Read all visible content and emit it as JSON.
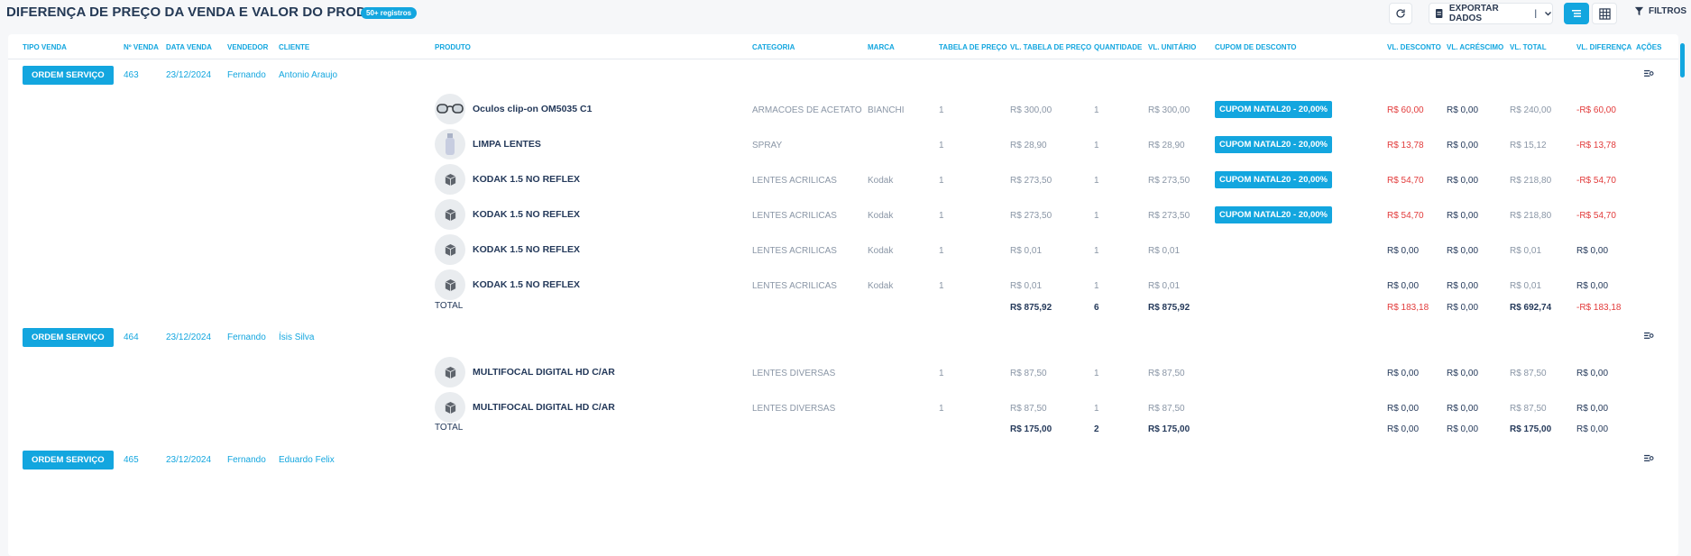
{
  "header": {
    "title": "DIFERENÇA DE PREÇO DA VENDA E VALOR DO PRODUTO",
    "badge": "50+ registros",
    "export_label": "EXPORTAR DADOS",
    "export_sep": "|",
    "filters_label": "FILTROS"
  },
  "columns": {
    "tipo": "TIPO VENDA",
    "nvenda": "Nº VENDA",
    "data": "DATA VENDA",
    "vendedor": "VENDEDOR",
    "cliente": "CLIENTE",
    "produto": "PRODUTO",
    "categoria": "CATEGORIA",
    "marca": "MARCA",
    "tabela": "TABELA DE PREÇO",
    "vltabela": "VL. TABELA DE PREÇO",
    "qtd": "QUANTIDADE",
    "vlunit": "VL. UNITÁRIO",
    "cupom": "CUPOM DE DESCONTO",
    "vldesc": "VL. DESCONTO",
    "vlacres": "VL. ACRÉSCIMO",
    "vltotal": "VL. TOTAL",
    "vldif": "VL. DIFERENÇA",
    "acoes": "AÇÕES"
  },
  "colors": {
    "accent": "#13a6df",
    "text": "#24395a",
    "muted": "#8a96a6",
    "negative": "#e23b3b"
  },
  "sales": [
    {
      "tipo": "ORDEM SERVIÇO",
      "numero": "463",
      "data": "23/12/2024",
      "vendedor": "Fernando",
      "cliente": "Antonio Araujo",
      "items": [
        {
          "produto": "Oculos clip-on OM5035 C1",
          "thumb": "glasses",
          "categoria": "ARMACOES DE ACETATO",
          "marca": "BIANCHI",
          "tabela": "1",
          "vltabela": "R$ 300,00",
          "qtd": "1",
          "vlunit": "R$ 300,00",
          "cupom": "CUPOM NATAL20 - 20,00%",
          "vldesc": "R$ 60,00",
          "vlacres": "R$ 0,00",
          "vltotal": "R$ 240,00",
          "vldif": "-R$ 60,00",
          "neg": true
        },
        {
          "produto": "LIMPA LENTES",
          "thumb": "spray",
          "categoria": "SPRAY",
          "marca": "",
          "tabela": "1",
          "vltabela": "R$ 28,90",
          "qtd": "1",
          "vlunit": "R$ 28,90",
          "cupom": "CUPOM NATAL20 - 20,00%",
          "vldesc": "R$ 13,78",
          "vlacres": "R$ 0,00",
          "vltotal": "R$ 15,12",
          "vldif": "-R$ 13,78",
          "neg": true
        },
        {
          "produto": "KODAK 1.5 NO REFLEX",
          "thumb": "box",
          "categoria": "LENTES ACRILICAS",
          "marca": "Kodak",
          "tabela": "1",
          "vltabela": "R$ 273,50",
          "qtd": "1",
          "vlunit": "R$ 273,50",
          "cupom": "CUPOM NATAL20 - 20,00%",
          "vldesc": "R$ 54,70",
          "vlacres": "R$ 0,00",
          "vltotal": "R$ 218,80",
          "vldif": "-R$ 54,70",
          "neg": true
        },
        {
          "produto": "KODAK 1.5 NO REFLEX",
          "thumb": "box",
          "categoria": "LENTES ACRILICAS",
          "marca": "Kodak",
          "tabela": "1",
          "vltabela": "R$ 273,50",
          "qtd": "1",
          "vlunit": "R$ 273,50",
          "cupom": "CUPOM NATAL20 - 20,00%",
          "vldesc": "R$ 54,70",
          "vlacres": "R$ 0,00",
          "vltotal": "R$ 218,80",
          "vldif": "-R$ 54,70",
          "neg": true
        },
        {
          "produto": "KODAK 1.5 NO REFLEX",
          "thumb": "box",
          "categoria": "LENTES ACRILICAS",
          "marca": "Kodak",
          "tabela": "1",
          "vltabela": "R$ 0,01",
          "qtd": "1",
          "vlunit": "R$ 0,01",
          "cupom": "",
          "vldesc": "R$ 0,00",
          "vlacres": "R$ 0,00",
          "vltotal": "R$ 0,01",
          "vldif": "R$ 0,00",
          "neg": false
        },
        {
          "produto": "KODAK 1.5 NO REFLEX",
          "thumb": "box",
          "categoria": "LENTES ACRILICAS",
          "marca": "Kodak",
          "tabela": "1",
          "vltabela": "R$ 0,01",
          "qtd": "1",
          "vlunit": "R$ 0,01",
          "cupom": "",
          "vldesc": "R$ 0,00",
          "vlacres": "R$ 0,00",
          "vltotal": "R$ 0,01",
          "vldif": "R$ 0,00",
          "neg": false
        }
      ],
      "total": {
        "label": "TOTAL",
        "vltabela": "R$ 875,92",
        "qtd": "6",
        "vlunit": "R$ 875,92",
        "vldesc": "R$ 183,18",
        "vlacres": "R$ 0,00",
        "vltotal": "R$ 692,74",
        "vldif": "-R$ 183,18",
        "neg": true
      }
    },
    {
      "tipo": "ORDEM SERVIÇO",
      "numero": "464",
      "data": "23/12/2024",
      "vendedor": "Fernando",
      "cliente": "Ísis Silva",
      "items": [
        {
          "produto": "MULTIFOCAL DIGITAL HD C/AR",
          "thumb": "box",
          "categoria": "LENTES DIVERSAS",
          "marca": "",
          "tabela": "1",
          "vltabela": "R$ 87,50",
          "qtd": "1",
          "vlunit": "R$ 87,50",
          "cupom": "",
          "vldesc": "R$ 0,00",
          "vlacres": "R$ 0,00",
          "vltotal": "R$ 87,50",
          "vldif": "R$ 0,00",
          "neg": false
        },
        {
          "produto": "MULTIFOCAL DIGITAL HD C/AR",
          "thumb": "box",
          "categoria": "LENTES DIVERSAS",
          "marca": "",
          "tabela": "1",
          "vltabela": "R$ 87,50",
          "qtd": "1",
          "vlunit": "R$ 87,50",
          "cupom": "",
          "vldesc": "R$ 0,00",
          "vlacres": "R$ 0,00",
          "vltotal": "R$ 87,50",
          "vldif": "R$ 0,00",
          "neg": false
        }
      ],
      "total": {
        "label": "TOTAL",
        "vltabela": "R$ 175,00",
        "qtd": "2",
        "vlunit": "R$ 175,00",
        "vldesc": "R$ 0,00",
        "vlacres": "R$ 0,00",
        "vltotal": "R$ 175,00",
        "vldif": "R$ 0,00",
        "neg": false
      }
    },
    {
      "tipo": "ORDEM SERVIÇO",
      "numero": "465",
      "data": "23/12/2024",
      "vendedor": "Fernando",
      "cliente": "Eduardo Felix",
      "items": [],
      "total": null
    }
  ]
}
